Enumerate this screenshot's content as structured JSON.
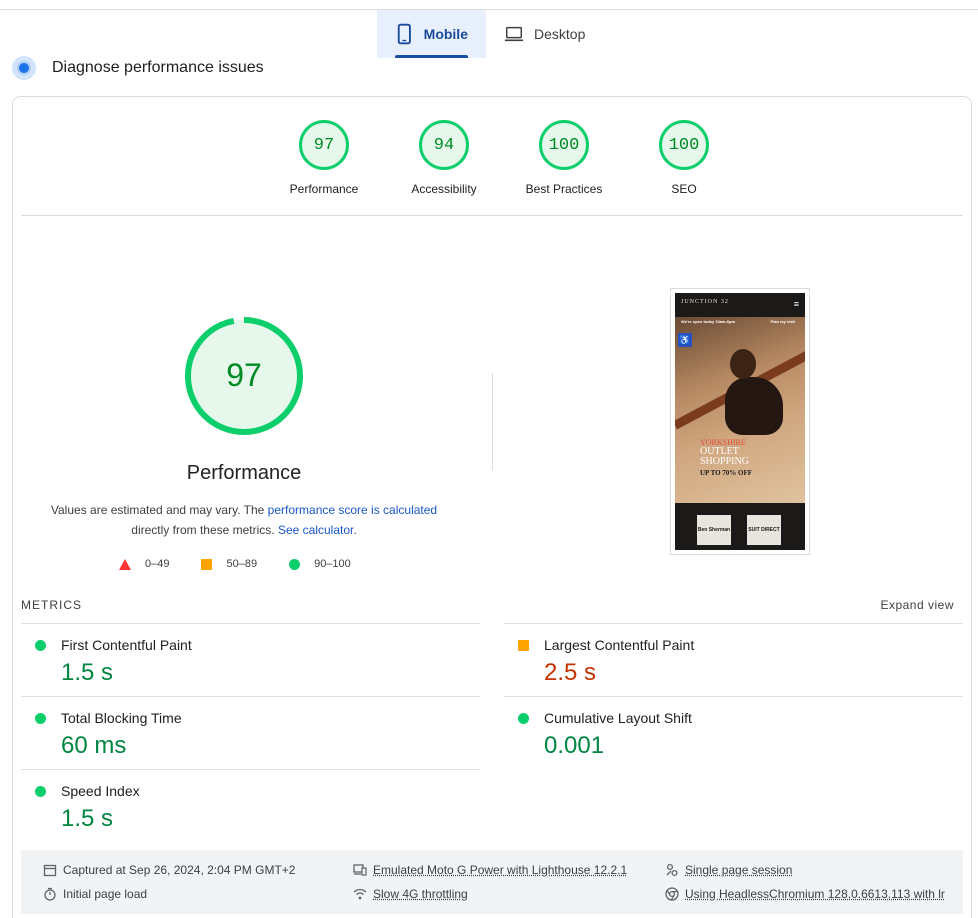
{
  "tabs": [
    {
      "label": "Mobile",
      "active": true,
      "icon": "phone-icon"
    },
    {
      "label": "Desktop",
      "active": false,
      "icon": "laptop-icon"
    }
  ],
  "section_title": "Diagnose performance issues",
  "categories": [
    {
      "score": "97",
      "label": "Performance"
    },
    {
      "score": "94",
      "label": "Accessibility"
    },
    {
      "score": "100",
      "label": "Best Practices"
    },
    {
      "score": "100",
      "label": "SEO"
    }
  ],
  "performance": {
    "score": "97",
    "score_fraction": 0.97,
    "title": "Performance",
    "desc_prefix": "Values are estimated and may vary. The ",
    "desc_link1": "performance score is calculated",
    "desc_mid": "directly from these metrics.",
    "desc_link2": "See calculator",
    "desc_suffix": "."
  },
  "legend": [
    {
      "range": "0–49",
      "shape": "triangle",
      "color": "#ff3333"
    },
    {
      "range": "50–89",
      "shape": "square",
      "color": "#ffa400"
    },
    {
      "range": "90–100",
      "shape": "circle",
      "color": "#0cce6b"
    }
  ],
  "screenshot": {
    "logo": "JUNCTION 32",
    "note_left": "We're open today 10am-6pm",
    "note_right": "Plan my visit",
    "promo_line1": "YORKSHIRE",
    "promo_line2": "OUTLET",
    "promo_line3": "SHOPPING",
    "promo_line4": "UP TO 70% OFF",
    "brand1": "Ben Sherman",
    "brand2": "SUIT DIRECT"
  },
  "metrics_heading": "METRICS",
  "expand_label": "Expand view",
  "metrics": [
    {
      "name": "First Contentful Paint",
      "value": "1.5 s",
      "status": "good"
    },
    {
      "name": "Largest Contentful Paint",
      "value": "2.5 s",
      "status": "average"
    },
    {
      "name": "Total Blocking Time",
      "value": "60 ms",
      "status": "good"
    },
    {
      "name": "Cumulative Layout Shift",
      "value": "0.001",
      "status": "good"
    },
    {
      "name": "Speed Index",
      "value": "1.5 s",
      "status": "good"
    }
  ],
  "footer": {
    "captured": "Captured at Sep 26, 2024, 2:04 PM GMT+2",
    "load": "Initial page load",
    "device": "Emulated Moto G Power with Lighthouse 12.2.1",
    "throttle": "Slow 4G throttling",
    "session": "Single page session",
    "browser": "Using HeadlessChromium 128.0.6613.113 with lr"
  },
  "colors": {
    "good": "#0cce6b",
    "good_text": "#018642",
    "average": "#ffa400",
    "average_text": "#c33300",
    "accent": "#1a73e8"
  }
}
